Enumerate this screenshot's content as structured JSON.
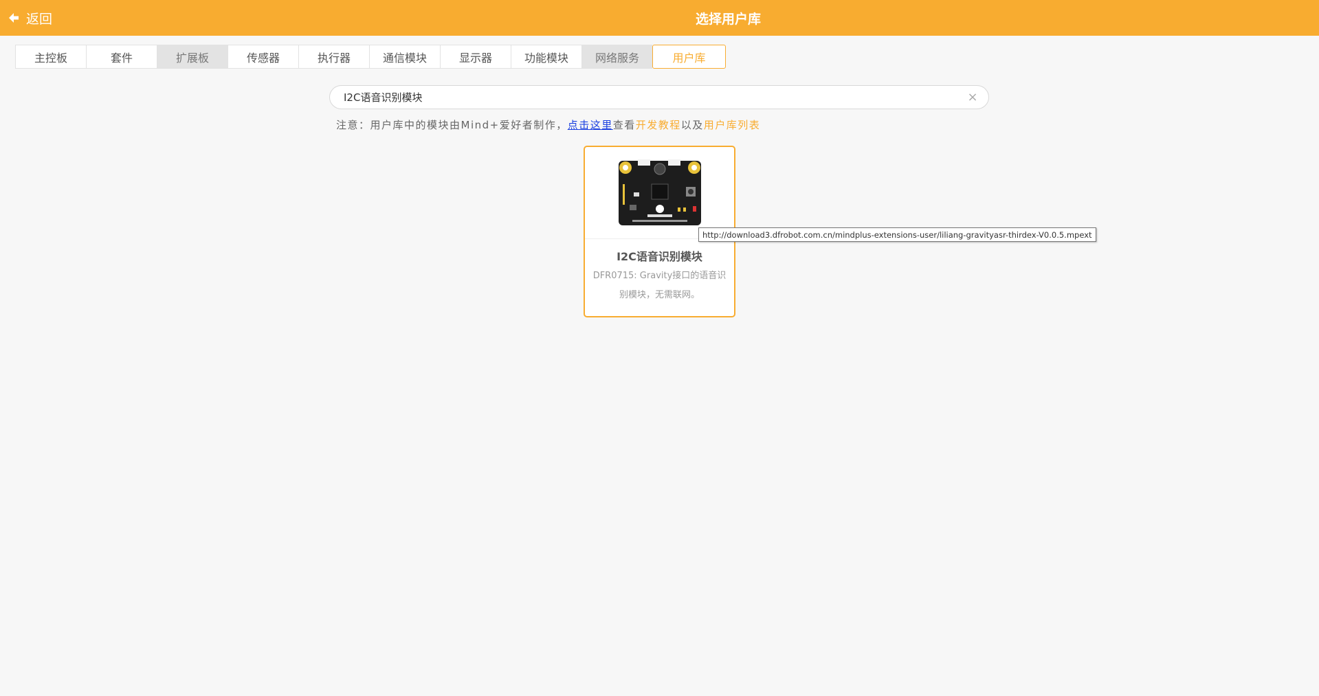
{
  "header": {
    "back_label": "返回",
    "title": "选择用户库"
  },
  "tabs": [
    {
      "label": "主控板",
      "style": "normal"
    },
    {
      "label": "套件",
      "style": "normal"
    },
    {
      "label": "扩展板",
      "style": "gray"
    },
    {
      "label": "传感器",
      "style": "normal"
    },
    {
      "label": "执行器",
      "style": "normal"
    },
    {
      "label": "通信模块",
      "style": "normal"
    },
    {
      "label": "显示器",
      "style": "normal"
    },
    {
      "label": "功能模块",
      "style": "normal"
    },
    {
      "label": "网络服务",
      "style": "gray"
    },
    {
      "label": "用户库",
      "style": "active"
    }
  ],
  "search": {
    "value": "I2C语音识别模块",
    "clear_symbol": "×"
  },
  "notice": {
    "prefix": "注意：用户库中的模块由Mind+爱好者制作，",
    "link": "点击这里",
    "middle1": "查看",
    "tutorial": "开发教程",
    "middle2": "以及",
    "list": "用户库列表"
  },
  "card": {
    "title": "I2C语音识别模块",
    "description": "DFR0715: Gravity接口的语音识别模块，无需联网。",
    "image_icon": "speech-recognition-board-image"
  },
  "tooltip": {
    "text": "http://download3.dfrobot.com.cn/mindplus-extensions-user/liliang-gravityasr-thirdex-V0.0.5.mpext"
  },
  "colors": {
    "accent": "#f8ac30",
    "link": "#1a3fe0",
    "background": "#f7f7f7"
  }
}
